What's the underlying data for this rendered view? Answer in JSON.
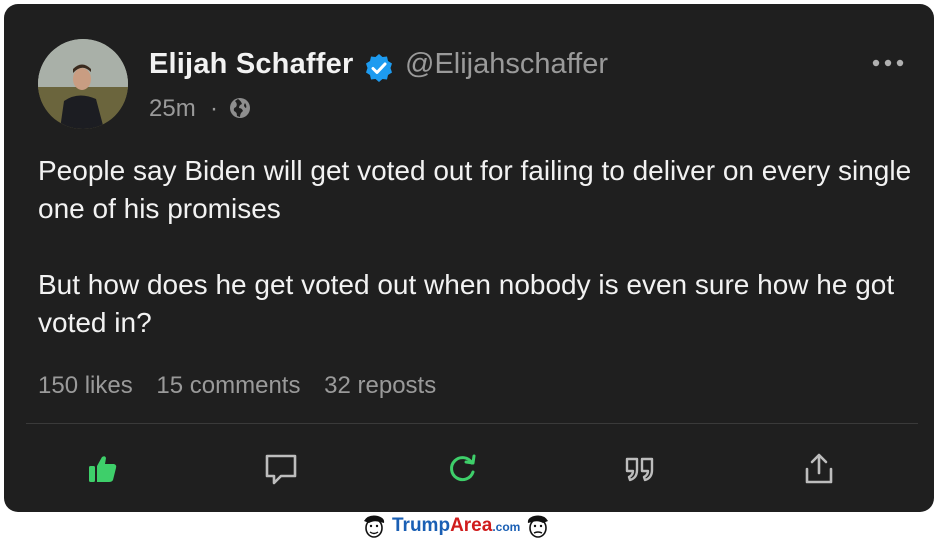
{
  "post": {
    "author_name": "Elijah Schaffer",
    "handle": "@Elijahschaffer",
    "time": "25m",
    "separator": "·",
    "verified_icon": "verified-badge-icon",
    "visibility_icon": "globe-icon",
    "body": [
      "People say Biden will get voted out for failing to deliver on every single one of his promises",
      "But how does he get voted out when nobody is even sure how he got voted in?"
    ],
    "stats": {
      "likes": "150 likes",
      "comments": "15 comments",
      "reposts": "32 reposts"
    }
  },
  "actions": [
    {
      "name": "like",
      "icon": "thumbs-up-icon",
      "color": "#3ecf6a"
    },
    {
      "name": "comment",
      "icon": "comment-icon",
      "color": "#bdbdbd"
    },
    {
      "name": "repost",
      "icon": "repost-icon",
      "color": "#3ecf6a"
    },
    {
      "name": "quote",
      "icon": "quote-icon",
      "color": "#bdbdbd"
    },
    {
      "name": "share",
      "icon": "share-icon",
      "color": "#bdbdbd"
    }
  ],
  "watermark": {
    "part1": "Trump",
    "part2": "Area",
    "part3": ".com"
  },
  "colors": {
    "card_background": "#1f1f1f",
    "verified_blue": "#1d9bf0",
    "accent_green": "#3ecf6a"
  }
}
